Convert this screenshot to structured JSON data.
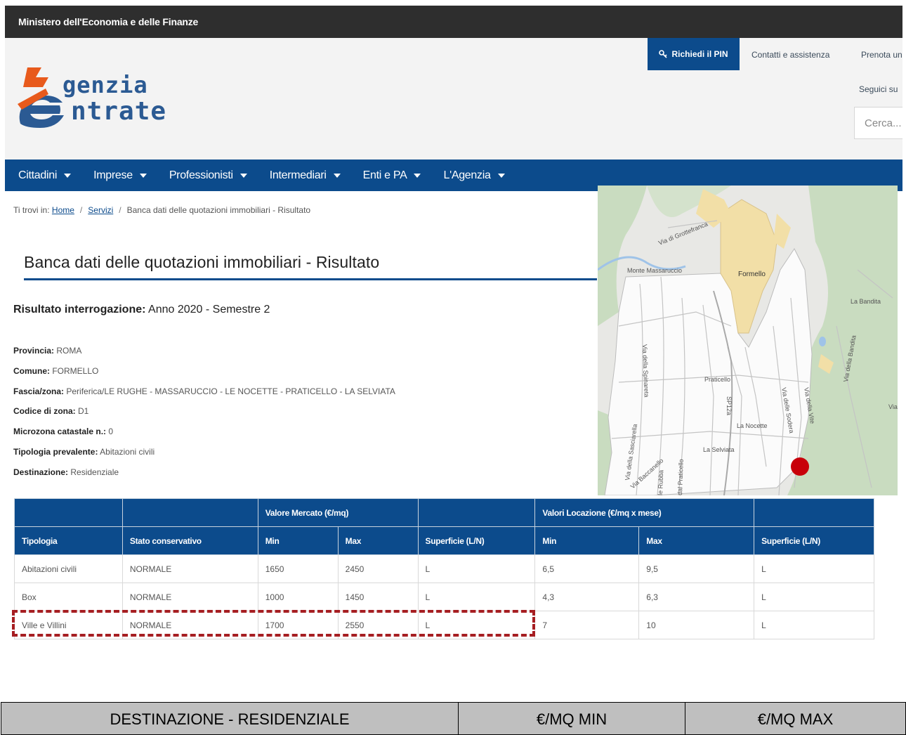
{
  "topbar": {
    "title": "Ministero dell'Economia e delle Finanze"
  },
  "logo": {
    "line1": "genzia",
    "line2": "ntrate"
  },
  "header": {
    "pin_button": "Richiedi il PIN",
    "contatti": "Contatti e assistenza",
    "prenota": "Prenota un",
    "seguici": "Seguici su",
    "search_placeholder": "Cerca..."
  },
  "nav": {
    "items": [
      "Cittadini",
      "Imprese",
      "Professionisti",
      "Intermediari",
      "Enti e PA",
      "L'Agenzia"
    ]
  },
  "breadcrumb": {
    "prefix": "Ti trovi in:",
    "home": "Home",
    "servizi": "Servizi",
    "current": "Banca dati delle quotazioni immobiliari - Risultato"
  },
  "page_title": "Banca dati delle quotazioni immobiliari - Risultato",
  "result": {
    "label": "Risultato interrogazione:",
    "value": "Anno 2020 - Semestre 2"
  },
  "info": [
    {
      "label": "Provincia:",
      "value": "ROMA"
    },
    {
      "label": "Comune:",
      "value": "FORMELLO"
    },
    {
      "label": "Fascia/zona:",
      "value": "Periferica/LE RUGHE - MASSARUCCIO - LE NOCETTE - PRATICELLO - LA SELVIATA"
    },
    {
      "label": "Codice di zona:",
      "value": "D1"
    },
    {
      "label": "Microzona catastale n.:",
      "value": "0"
    },
    {
      "label": "Tipologia prevalente:",
      "value": "Abitazioni civili"
    },
    {
      "label": "Destinazione:",
      "value": "Residenziale"
    }
  ],
  "map": {
    "labels": [
      "Via di Grottefranca",
      "Monte Massaruccio",
      "Formello",
      "La Bandita",
      "Via della Spinareta",
      "Praticello",
      "Via delle Sodera",
      "Via della Vite",
      "Via della Bandita",
      "La Nocette",
      "SP12a",
      "La Selviata",
      "Via della Sasciarella",
      "Via Baccanello",
      "le Rubba",
      "dal Praticello",
      "Via"
    ]
  },
  "table": {
    "header_top": {
      "tipologia": "Tipologia",
      "stato": "Stato conservativo",
      "mercato": "Valore Mercato (€/mq)",
      "locazione": "Valori Locazione (€/mq x mese)"
    },
    "header_sub": {
      "min": "Min",
      "max": "Max",
      "superficie": "Superficie (L/N)"
    },
    "rows": [
      [
        "Abitazioni civili",
        "NORMALE",
        "1650",
        "2450",
        "L",
        "6,5",
        "9,5",
        "L"
      ],
      [
        "Box",
        "NORMALE",
        "1000",
        "1450",
        "L",
        "4,3",
        "6,3",
        "L"
      ],
      [
        "Ville e Villini",
        "NORMALE",
        "1700",
        "2550",
        "L",
        "7",
        "10",
        "L"
      ]
    ]
  },
  "summary": {
    "col1": "DESTINAZIONE - RESIDENZIALE",
    "col2": "€/MQ MIN",
    "col3": "€/MQ MAX"
  },
  "colors": {
    "brand_blue": "#0c4b8c",
    "dark_bar": "#2e2e2e",
    "highlight_red": "#a61e22",
    "map_marker": "#c8000a"
  }
}
